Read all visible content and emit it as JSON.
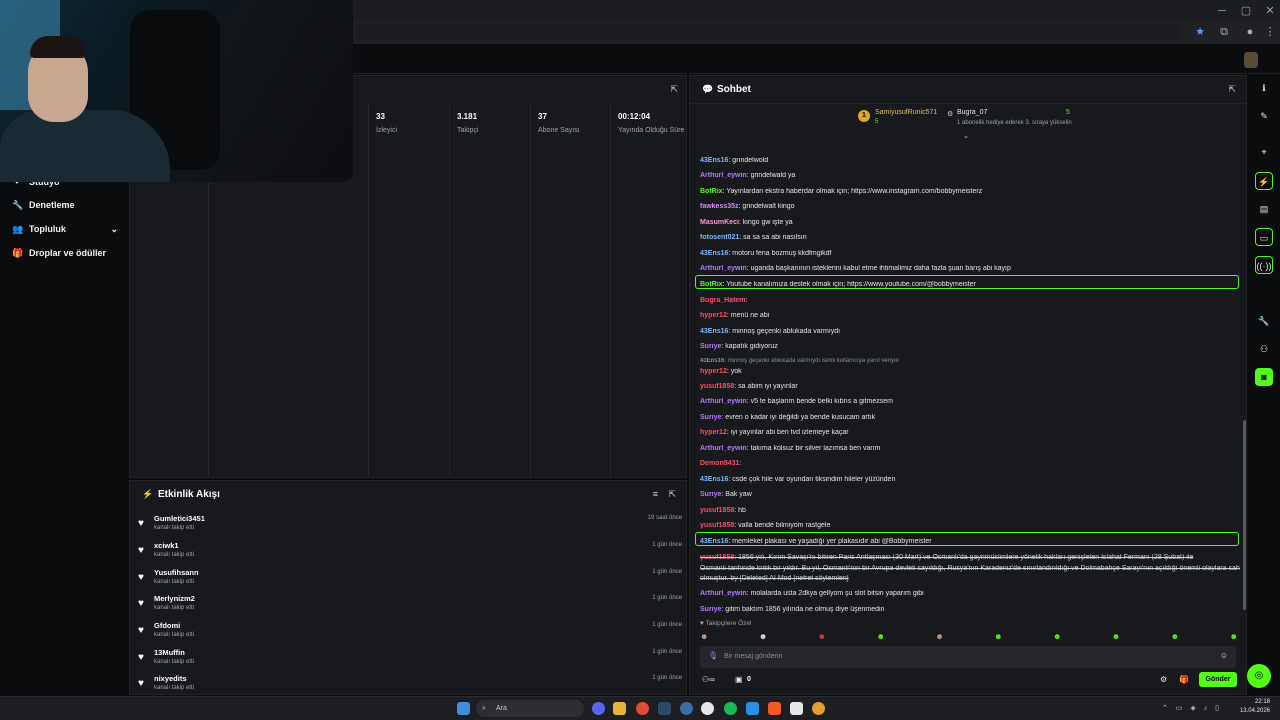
{
  "header": {
    "search_placeholder": "Ara"
  },
  "sidebar": {
    "items": [
      {
        "label": "Stüdyo",
        "icon": "studio-icon"
      },
      {
        "label": "Denetleme",
        "icon": "wrench-icon"
      },
      {
        "label": "Topluluk",
        "icon": "users-icon"
      },
      {
        "label": "Droplar ve ödüller",
        "icon": "gift-icon"
      }
    ]
  },
  "stats": [
    {
      "value": "33",
      "label": "İzleyici"
    },
    {
      "value": "3.181",
      "label": "Takipçi"
    },
    {
      "value": "37",
      "label": "Abone Sayısı"
    },
    {
      "value": "00:12:04",
      "label": "Yayında Olduğu Süre"
    }
  ],
  "feed": {
    "title": "Etkinlik Akışı",
    "rows": [
      {
        "name": "Gumletici3451",
        "sub": "kanalı takip etti",
        "time": "19 saat önce"
      },
      {
        "name": "xciwk1",
        "sub": "kanalı takip etti",
        "time": "1 gün önce"
      },
      {
        "name": "Yusufihsann",
        "sub": "kanalı takip etti",
        "time": "1 gün önce"
      },
      {
        "name": "Merlynizm2",
        "sub": "kanalı takip etti",
        "time": "1 gün önce"
      },
      {
        "name": "Gfdomi",
        "sub": "kanalı takip etti",
        "time": "1 gün önce"
      },
      {
        "name": "13Muffin",
        "sub": "kanalı takip etti",
        "time": "1 gün önce"
      },
      {
        "name": "nixyedits",
        "sub": "kanalı takip etti",
        "time": "1 gün önce"
      }
    ]
  },
  "chat": {
    "title": "Sohbet",
    "leaderboard": {
      "first": {
        "name": "SamiyusufRunic571",
        "count": "5"
      },
      "second": {
        "name": "Bugra_07",
        "count": "5",
        "note": "1 abonelik hediye ederek 3. sıraya yükselin"
      }
    },
    "messages": [
      {
        "user": "43Ens16",
        "text": ": grındelwold",
        "color": "#7ab8ff"
      },
      {
        "user": "Arthurl_eywin",
        "text": ": grindelwald ya",
        "color": "#b57bff"
      },
      {
        "user": "BotRix",
        "text": ": Yayınlardan ekstra haberdar olmak için; https://www.instagram.com/bobbymeisterz",
        "color": "#53fc18"
      },
      {
        "user": "fawkess35z",
        "text": ": grindelwalt kingo",
        "color": "#d48cff"
      },
      {
        "user": "MasumKeci",
        "text": ": kingo gw işte ya",
        "color": "#ff9ad5"
      },
      {
        "user": "fotosent021",
        "text": ": sa sa sa abi nasılsın",
        "color": "#7ab8ff"
      },
      {
        "user": "43Ens16",
        "text": ": motoru fena bozmuş kkdfmgikdf",
        "color": "#7ab8ff"
      },
      {
        "user": "Arthurl_eywin",
        "text": ": uganda başkanının isteklerini kabul etme ihtimalimiz daha fazla şuan barış abi kayıp",
        "color": "#b57bff"
      },
      {
        "user": "BotRix",
        "text": ": Youtube kanalımıza destek olmak için; https://www.youtube.com/@bobbymeister",
        "color": "#53fc18"
      },
      {
        "user": "Bugra_Hatem",
        "text": ":",
        "color": "#ff4f6a"
      },
      {
        "user": "hyper12",
        "text": ": menü ne abi",
        "color": "#ff4f6a"
      },
      {
        "user": "43Ens16",
        "text": ": minnoş geçenki ablukada varmıydı",
        "color": "#7ab8ff"
      },
      {
        "user": "Suriye",
        "text": ": kapatık gidiyoruz",
        "color": "#b57bff"
      },
      {
        "user": "43Ens16",
        "text": ": minnoş geçenki ablukada varmıydı isimli kullanıcıya yanıt veriyor",
        "color": "#8a8f96"
      },
      {
        "user": "hyper12",
        "text": ": yok",
        "color": "#ff4f6a"
      },
      {
        "user": "yusuf1858",
        "text": ": sa abim iyi yayınlar",
        "color": "#ff4f6a"
      },
      {
        "user": "Arthurl_eywin",
        "text": ": v5 te başlarım bende belki kıbrıs a gitmezsem",
        "color": "#b57bff"
      },
      {
        "user": "Suriye",
        "text": ": evren o kadar iyi değildi ya bende kusucam artık",
        "color": "#b57bff"
      },
      {
        "user": "hyper12",
        "text": ": iyi yayınlar abi ben tvd izlemeye kaçar",
        "color": "#ff4f6a"
      },
      {
        "user": "Arthurl_eywin",
        "text": ": takıma kolsuz bir silver lazımsa ben varım",
        "color": "#b57bff"
      },
      {
        "user": "Demon5431",
        "text": ":",
        "color": "#ff4f6a"
      },
      {
        "user": "43Ens16",
        "text": ": csde çok hile var oyundan tiksindim hileler yüzünden",
        "color": "#7ab8ff"
      },
      {
        "user": "Suriye",
        "text": ": Bak yaw",
        "color": "#b57bff"
      },
      {
        "user": "yusuf1858",
        "text": ": hb",
        "color": "#ff4f6a"
      },
      {
        "user": "yusuf1858",
        "text": ": valla bende bilmiyom rastgele",
        "color": "#ff4f6a"
      },
      {
        "user": "43Ens16",
        "text": ": memleket plakası ve yaşadığı yer plakasıdır abi @Bobbymeister",
        "color": "#7ab8ff"
      },
      {
        "user": "yusuf1858",
        "text": ": 1856 yılı, Kırım Savaşı'nı bitiren Paris Antlaşması (30 Mart) ve Osmanlı'da gayrimüslimlere yönelik hakları genişleten Islahat Fermanı (28 Şubat) ile",
        "color": "#ff4f6a"
      },
      {
        "user": "",
        "text": "Osmanlı tarihinde kritik bir yıldır. Bu yıl, Osmanlı'nın bir Avrupa devleti sayıldığı, Rusya'nın Karadeniz'de sınırlandırıldığı ve Dolmabahçe Sarayı'nın açıldığı önemli olaylara sahne",
        "color": "#e6e7e9"
      },
      {
        "user": "",
        "text": "olmuştur. by [Deleted]  AI Mod  [nefret söylemleri]",
        "color": "#e6e7e9"
      },
      {
        "user": "Arthurl_eywin",
        "text": ": molalarda usta 2dkya gellyom şu slot bitsin yaparım gibi",
        "color": "#b57bff"
      },
      {
        "user": "Suriye",
        "text": ": gitim baktım 1856 yılında ne olmuş diye üşenmedin",
        "color": "#b57bff"
      }
    ],
    "followers_only": "Takipçilere Özel",
    "input_placeholder": "Bir mesaj gönderin",
    "send_label": "Gönder",
    "points": "0"
  },
  "taskbar": {
    "time": "22:18",
    "date": "13.04.2026"
  }
}
